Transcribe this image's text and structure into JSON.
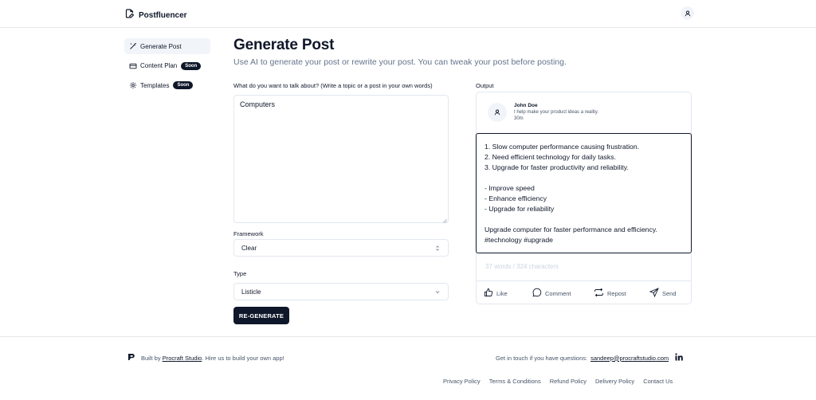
{
  "app": {
    "name": "Postfluencer"
  },
  "sidebar": {
    "items": [
      {
        "label": "Generate Post",
        "icon": "magic-wand-icon",
        "active": true
      },
      {
        "label": "Content Plan",
        "icon": "credit-card-icon",
        "badge": "Soon"
      },
      {
        "label": "Templates",
        "icon": "gear-icon",
        "badge": "Soon"
      }
    ]
  },
  "main": {
    "title": "Generate Post",
    "subtitle": "Use AI to generate your post or rewrite your post. You can tweak your post before posting.",
    "topic_label": "What do you want to talk about? (Write a topic or a post in your own words)",
    "topic_value": "Computers",
    "framework_label": "Framework",
    "framework_value": "Clear",
    "type_label": "Type",
    "type_value": "Listicle",
    "regenerate_label": "RE-GENERATE"
  },
  "output": {
    "label": "Output",
    "author": "John Doe",
    "tagline": "I help make your product ideas a reality.",
    "time": "30m",
    "post_lines": [
      "1. Slow computer performance causing frustration.",
      "2. Need efficient technology for daily tasks.",
      "3. Upgrade for faster productivity and reliability.",
      "",
      "- Improve speed",
      "- Enhance efficiency",
      "- Upgrade for reliability",
      "",
      "Upgrade computer for faster performance and efficiency.",
      "#technology #upgrade"
    ],
    "count": "37 words / 324 characters",
    "actions": {
      "like": "Like",
      "comment": "Comment",
      "repost": "Repost",
      "send": "Send"
    }
  },
  "footer": {
    "built_prefix": "Built by",
    "built_link": "Procraft Studio",
    "built_suffix": ". Hire us to build your own app!",
    "contact_prefix": "Get in touch if you have questions:",
    "contact_email": "sandeep@procraftstudio.com",
    "links": [
      "Privacy Policy",
      "Terms & Conditions",
      "Refund Policy",
      "Delivery Policy",
      "Contact Us"
    ]
  },
  "colors": {
    "primary": "#0f172a",
    "muted": "#64748b",
    "border": "#e2e8f0",
    "placeholder": "#cbd5e1"
  }
}
